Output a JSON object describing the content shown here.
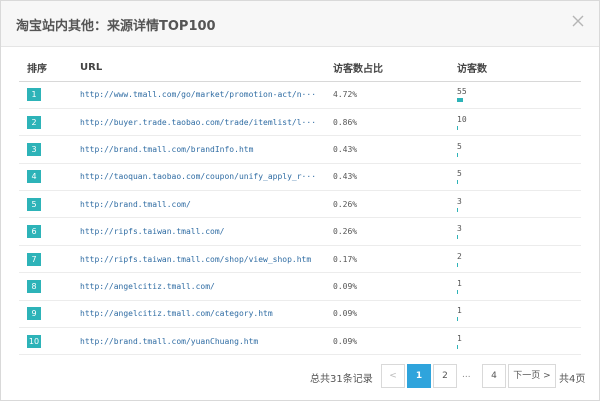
{
  "dialog": {
    "title": "淘宝站内其他：来源详情TOP100",
    "close_icon": "close-icon"
  },
  "table": {
    "headers": {
      "rank": "排序",
      "url": "URL",
      "pct": "访客数占比",
      "visitors": "访客数"
    },
    "rows": [
      {
        "rank": "1",
        "url": "http://www.tmall.com/go/market/promotion-act/n···",
        "pct": "4.72%",
        "visitors": "55",
        "visitors_value": 55
      },
      {
        "rank": "2",
        "url": "http://buyer.trade.taobao.com/trade/itemlist/l···",
        "pct": "0.86%",
        "visitors": "10",
        "visitors_value": 10
      },
      {
        "rank": "3",
        "url": "http://brand.tmall.com/brandInfo.htm",
        "pct": "0.43%",
        "visitors": "5",
        "visitors_value": 5
      },
      {
        "rank": "4",
        "url": "http://taoquan.taobao.com/coupon/unify_apply_r···",
        "pct": "0.43%",
        "visitors": "5",
        "visitors_value": 5
      },
      {
        "rank": "5",
        "url": "http://brand.tmall.com/",
        "pct": "0.26%",
        "visitors": "3",
        "visitors_value": 3
      },
      {
        "rank": "6",
        "url": "http://ripfs.taiwan.tmall.com/",
        "pct": "0.26%",
        "visitors": "3",
        "visitors_value": 3
      },
      {
        "rank": "7",
        "url": "http://ripfs.taiwan.tmall.com/shop/view_shop.htm",
        "pct": "0.17%",
        "visitors": "2",
        "visitors_value": 2
      },
      {
        "rank": "8",
        "url": "http://angelcitiz.tmall.com/",
        "pct": "0.09%",
        "visitors": "1",
        "visitors_value": 1
      },
      {
        "rank": "9",
        "url": "http://angelcitiz.tmall.com/category.htm",
        "pct": "0.09%",
        "visitors": "1",
        "visitors_value": 1
      },
      {
        "rank": "10",
        "url": "http://brand.tmall.com/yuanChuang.htm",
        "pct": "0.09%",
        "visitors": "1",
        "visitors_value": 1
      }
    ],
    "max_visitors": 55
  },
  "pager": {
    "total_records": "总共31条记录",
    "prev_label": "<",
    "pages": [
      "1",
      "2",
      "4"
    ],
    "current_page": "1",
    "ellipsis": "...",
    "next_label": "下一页 >",
    "total_pages": "共4页"
  },
  "colors": {
    "accent": "#2db3b8",
    "active_page": "#2fa4dc",
    "link": "#2f6ca3"
  }
}
